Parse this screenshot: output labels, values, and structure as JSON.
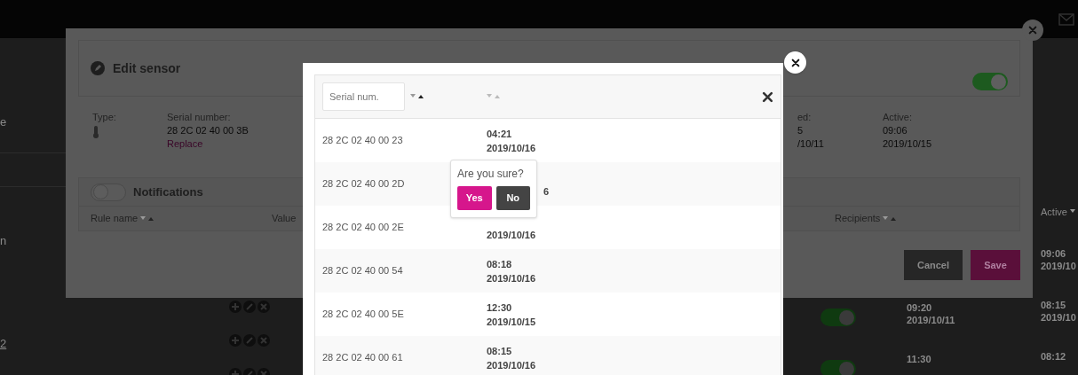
{
  "background": {
    "edge_letters": [
      "e",
      "n",
      "2"
    ],
    "active_column": {
      "heading": "Active",
      "rows": [
        {
          "time": "09:06",
          "date": "2019/10"
        },
        {
          "time": "08:15",
          "date": "2019/10"
        },
        {
          "time": "08:12"
        }
      ]
    },
    "rows": [
      {
        "time": "09:20",
        "date": "2019/10/11",
        "on": true
      },
      {
        "time": "11:30",
        "on": true
      }
    ]
  },
  "edit_sensor": {
    "title": "Edit sensor",
    "enabled": true,
    "info": [
      {
        "kind": "type",
        "label": "Type:"
      },
      {
        "kind": "serial",
        "label": "Serial number:",
        "value": "28 2C 02 40 00 3B",
        "link": "Replace"
      },
      {
        "kind": "plain",
        "label": "ed:",
        "value": "5",
        "extra": "/10/11"
      },
      {
        "kind": "plain",
        "label": "Active:",
        "value": "09:06",
        "extra": "2019/10/15"
      }
    ],
    "notifications": {
      "label": "Notifications",
      "on": false,
      "columns": [
        {
          "label": "Rule name",
          "sortable": true
        },
        {
          "label": "Value",
          "sortable": false
        },
        {
          "label": "Recipients",
          "sortable": true
        }
      ]
    },
    "buttons": {
      "cancel": "Cancel",
      "save": "Save"
    }
  },
  "serial_picker": {
    "filter": {
      "placeholder": "Serial num."
    },
    "rows": [
      {
        "serial": "28 2C 02 40 00 23",
        "time": "04:21",
        "date": "2019/10/16"
      },
      {
        "serial": "28 2C 02 40 00 2D",
        "date": "6",
        "kind": "covered"
      },
      {
        "serial": "28 2C 02 40 00 2E",
        "date": "2019/10/16"
      },
      {
        "serial": "28 2C 02 40 00 54",
        "time": "08:18",
        "date": "2019/10/16"
      },
      {
        "serial": "28 2C 02 40 00 5E",
        "time": "12:30",
        "date": "2019/10/15"
      },
      {
        "serial": "28 2C 02 40 00 61",
        "time": "08:15",
        "date": "2019/10/16"
      }
    ]
  },
  "confirm": {
    "question": "Are you sure?",
    "yes": "Yes",
    "no": "No"
  }
}
